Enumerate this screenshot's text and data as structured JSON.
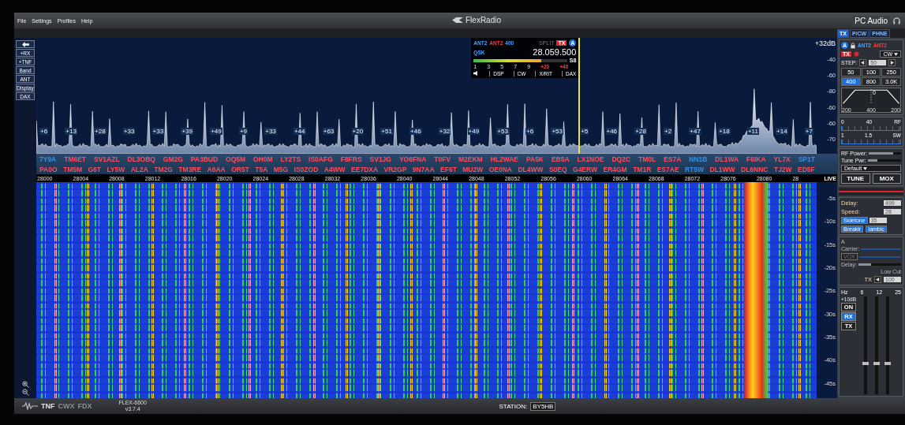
{
  "menu": [
    "File",
    "Settings",
    "Profiles",
    "Help"
  ],
  "app_title": "FlexRadio",
  "audio_label": "PC Audio",
  "side_buttons": [
    "+RX",
    "+TNF",
    "Band",
    "ANT",
    "Display",
    "DAX"
  ],
  "spectrum": {
    "top_label": "+32dB",
    "db_labels": [
      "-40",
      "-60",
      "-80",
      "-60",
      "-60",
      "-70"
    ],
    "snr_labels": [
      "+6",
      "+13",
      "+28",
      "+33",
      "+33",
      "+39",
      "+49",
      "+9",
      "+33",
      "+44",
      "+63",
      "+20",
      "+51",
      "+46",
      "+32",
      "+49",
      "+53",
      "+6",
      "+53",
      "+5",
      "+46",
      "+28",
      "+2",
      "+47",
      "+18",
      "+11",
      "+14",
      "+7"
    ]
  },
  "spots": {
    "upper": [
      {
        "call": "7Y9A",
        "color": "#3a8fe0"
      },
      {
        "call": "TM6ET",
        "color": "#ff4d5e"
      },
      {
        "call": "SV1AZL",
        "color": "#ff4d5e"
      },
      {
        "call": "DL3OBQ",
        "color": "#ff4d5e"
      },
      {
        "call": "GM2G",
        "color": "#ff4d5e"
      },
      {
        "call": "PA3BUD",
        "color": "#ff4d5e"
      },
      {
        "call": "OQ5M",
        "color": "#ff4d5e"
      },
      {
        "call": "OH0M",
        "color": "#ff4d5e"
      },
      {
        "call": "LY2TS",
        "color": "#ff4d5e"
      },
      {
        "call": "IS0AFG",
        "color": "#ff4d5e"
      },
      {
        "call": "F8FRS",
        "color": "#ff4d5e"
      },
      {
        "call": "SV1JG",
        "color": "#ff4d5e"
      },
      {
        "call": "YO6FNA",
        "color": "#ff4d5e"
      },
      {
        "call": "T0FV",
        "color": "#ff4d5e"
      },
      {
        "call": "M2EKM",
        "color": "#ff4d5e"
      },
      {
        "call": "HL2WAE",
        "color": "#ff4d5e"
      },
      {
        "call": "PA5K",
        "color": "#ff4d5e"
      },
      {
        "call": "EB5A",
        "color": "#ff4d5e"
      },
      {
        "call": "LX1NOE",
        "color": "#ff4d5e"
      },
      {
        "call": "DQ2C",
        "color": "#ff4d5e"
      },
      {
        "call": "TM0L",
        "color": "#ff4d5e"
      },
      {
        "call": "ES7A",
        "color": "#ff4d5e"
      },
      {
        "call": "NN1B",
        "color": "#3a8fe0"
      },
      {
        "call": "DL1WA",
        "color": "#ff4d5e"
      },
      {
        "call": "F6IKA",
        "color": "#ff4d5e"
      },
      {
        "call": "YL7X",
        "color": "#ff4d5e"
      },
      {
        "call": "SP1T",
        "color": "#3a8fe0"
      }
    ],
    "lower": [
      {
        "call": "PA0O",
        "color": "#ff4d5e"
      },
      {
        "call": "TM5M",
        "color": "#ff4d5e"
      },
      {
        "call": "G6T",
        "color": "#ff4d5e"
      },
      {
        "call": "LY5W",
        "color": "#ff4d5e"
      },
      {
        "call": "AL2A",
        "color": "#ff4d5e"
      },
      {
        "call": "TM2G",
        "color": "#ff4d5e"
      },
      {
        "call": "TM3RE",
        "color": "#ff4d5e"
      },
      {
        "call": "A6AA",
        "color": "#ff4d5e"
      },
      {
        "call": "OR5T",
        "color": "#ff4d5e"
      },
      {
        "call": "T5A",
        "color": "#ff4d5e"
      },
      {
        "call": "M5G",
        "color": "#ff4d5e"
      },
      {
        "call": "IS0ZOD",
        "color": "#ff4d5e"
      },
      {
        "call": "A4WW",
        "color": "#ff4d5e"
      },
      {
        "call": "EE7DXA",
        "color": "#ff4d5e"
      },
      {
        "call": "VR2GP",
        "color": "#ff4d5e"
      },
      {
        "call": "9N7AA",
        "color": "#ff4d5e"
      },
      {
        "call": "EF6T",
        "color": "#ff4d5e"
      },
      {
        "call": "MU2W",
        "color": "#ff4d5e"
      },
      {
        "call": "OE0NA",
        "color": "#ff4d5e"
      },
      {
        "call": "DL4WW",
        "color": "#ff4d5e"
      },
      {
        "call": "S0EQ",
        "color": "#ff4d5e"
      },
      {
        "call": "G4ERW",
        "color": "#ff4d5e"
      },
      {
        "call": "ER4GM",
        "color": "#ff4d5e"
      },
      {
        "call": "TM1R",
        "color": "#ff4d5e"
      },
      {
        "call": "ES7AE",
        "color": "#ff4d5e"
      },
      {
        "call": "RT5W",
        "color": "#3a8fe0"
      },
      {
        "call": "DL1WW",
        "color": "#ff4d5e"
      },
      {
        "call": "DL6NNC",
        "color": "#ff4d5e"
      },
      {
        "call": "TJ2W",
        "color": "#ff4d5e"
      },
      {
        "call": "ED5F",
        "color": "#ff4d5e"
      }
    ]
  },
  "frequency_ticks": [
    "28000",
    "28004",
    "28008",
    "28012",
    "28016",
    "28020",
    "28024",
    "28028",
    "28032",
    "28036",
    "28040",
    "28044",
    "28048",
    "28052",
    "28056",
    "28060",
    "28064",
    "28068",
    "28072",
    "28076",
    "28080",
    "28"
  ],
  "live_label": "LIVE",
  "time_labels": [
    "-5s",
    "-10s",
    "-15s",
    "-20s",
    "-25s",
    "-30s",
    "-35s",
    "-40s",
    "-45s"
  ],
  "slice": {
    "ant_rx": "ANT2",
    "ant_tx": "ANT2",
    "filter": "400",
    "qsk": "QSK",
    "split": "SPLIT",
    "tx": "TX",
    "letter": "A",
    "frequency": "28.059.500",
    "s_reading": "S8",
    "level": 0.72,
    "meter_ticks": [
      "1",
      "3",
      "5",
      "7",
      "9",
      "+20",
      "+40"
    ],
    "buttons": [
      "DSP",
      "CW",
      "X/RIT",
      "DAX"
    ]
  },
  "right_panel": {
    "tabs": [
      {
        "label": "TX",
        "selected": true
      },
      {
        "label": "P/CW",
        "selected": false
      },
      {
        "label": "PHNE",
        "selected": false
      }
    ],
    "slice_letter": "A",
    "tx_badge": "TX",
    "ant_rx": "ANT2",
    "ant_tx": "ANT2",
    "mode": "CW",
    "step_label": "STEP:",
    "step_value": "50",
    "filters": [
      {
        "label": "50",
        "selected": false
      },
      {
        "label": "100",
        "selected": false
      },
      {
        "label": "250",
        "selected": false
      },
      {
        "label": "400",
        "selected": true
      },
      {
        "label": "800",
        "selected": false
      },
      {
        "label": "3.0K",
        "selected": false
      }
    ],
    "filter_center": "0",
    "filter_ticks": [
      "200",
      "400",
      "200"
    ],
    "rf_meter_ticks": [
      "0",
      "40",
      "RF"
    ],
    "swr_meter_ticks": [
      "1",
      "1.5",
      "SW"
    ],
    "rf_power": {
      "label": "RF Power:",
      "level": 0.75
    },
    "tune_power": {
      "label": "Tune Pwr:",
      "level": 0.3
    },
    "profile": "Default",
    "tune": "TUNE",
    "mox": "MOX",
    "cw": {
      "delay_label": "Delay:",
      "delay": "499",
      "speed_label": "Speed:",
      "speed": "28",
      "sidetone": {
        "label": "Sidetone",
        "selected": true
      },
      "sidetone_value": "35",
      "breakin": {
        "label": "Breakir",
        "selected": true
      },
      "iambic": {
        "label": "Iambic",
        "selected": true
      }
    },
    "vox": {
      "title": "A",
      "carrier_label": "Carrier:",
      "button": {
        "label": "VOX",
        "selected": false
      },
      "delay_label": "Delay:",
      "delay_slider": {
        "level": 0.3
      },
      "low_cut_label": "Low Cut",
      "tx_label": "TX",
      "low_cut_value": "100"
    },
    "eq": {
      "hz_label": "Hz",
      "db_label": "+10dB",
      "bands": [
        {
          "label": "6",
          "level": 0.3
        },
        {
          "label": "12",
          "level": 0.3
        },
        {
          "label": "25",
          "level": 0.3
        }
      ],
      "buttons": [
        {
          "label": "ON",
          "selected": false
        },
        {
          "label": "RX",
          "selected": true
        },
        {
          "label": "TX",
          "selected": false
        }
      ]
    }
  },
  "bottom": {
    "features": [
      {
        "label": "TNF",
        "on": true
      },
      {
        "label": "CWX",
        "on": false
      },
      {
        "label": "FDX",
        "on": false
      }
    ],
    "model": "FLEX-6600",
    "version": "v3.7.4",
    "station_label": "STATION:",
    "station": "BY5HB"
  }
}
